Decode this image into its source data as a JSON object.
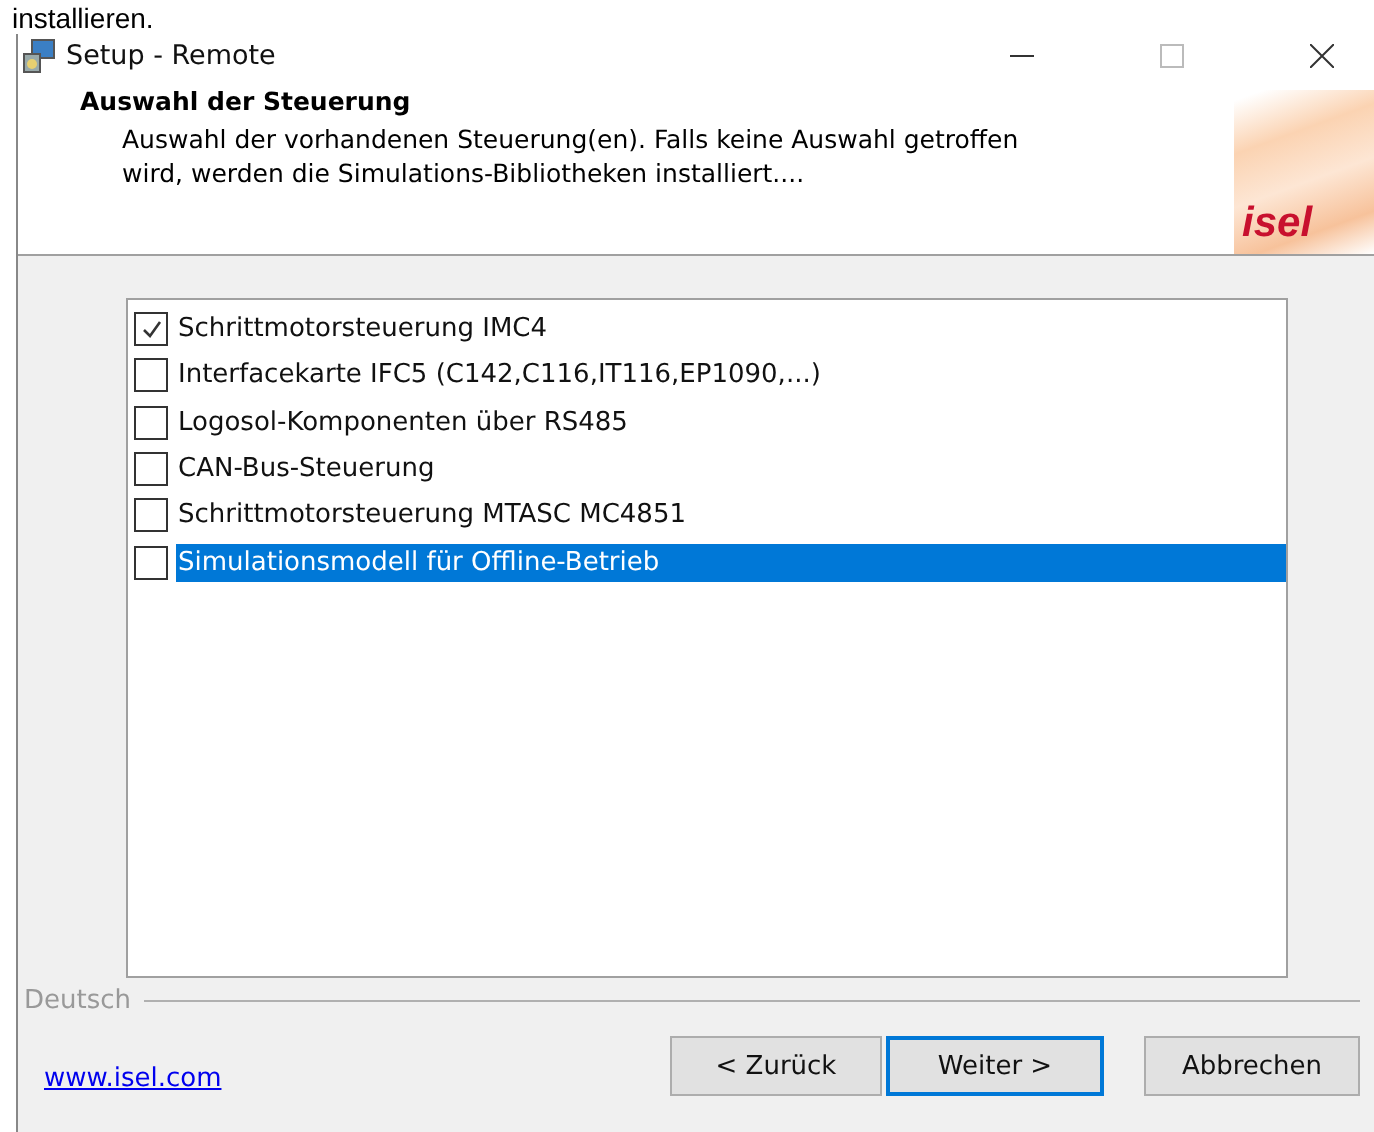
{
  "page_text": "installieren.",
  "window": {
    "title": "Setup - Remote"
  },
  "header": {
    "title": "Auswahl der Steuerung",
    "description": "Auswahl der vorhandenen Steuerung(en). Falls keine Auswahl getroffen wird, werden die Simulations-Bibliotheken installiert....",
    "logo": "isel"
  },
  "options": [
    {
      "label": "Schrittmotorsteuerung IMC4",
      "checked": true,
      "selected": false
    },
    {
      "label": "Interfacekarte IFC5 (C142,C116,IT116,EP1090,...)",
      "checked": false,
      "selected": false
    },
    {
      "label": "Logosol-Komponenten über RS485",
      "checked": false,
      "selected": false
    },
    {
      "label": "CAN-Bus-Steuerung",
      "checked": false,
      "selected": false
    },
    {
      "label": "Schrittmotorsteuerung MTASC MC4851",
      "checked": false,
      "selected": false
    },
    {
      "label": "Simulationsmodell für Offline-Betrieb",
      "checked": false,
      "selected": true
    }
  ],
  "language_label": "Deutsch",
  "link": "www.isel.com",
  "buttons": [
    {
      "label": "< Zurück",
      "default": false
    },
    {
      "label": "Weiter >",
      "default": true
    },
    {
      "label": "Abbrechen",
      "default": false
    }
  ]
}
